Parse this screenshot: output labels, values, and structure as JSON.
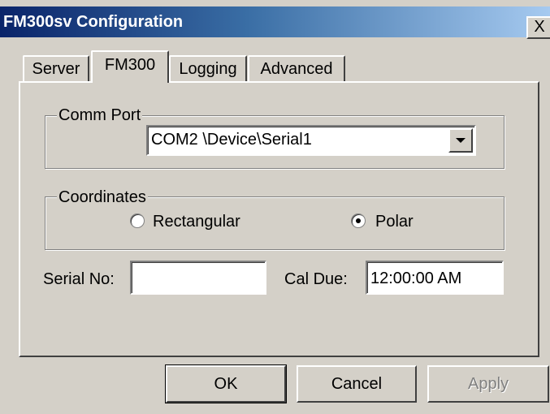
{
  "window": {
    "title": "FM300sv Configuration",
    "close_glyph": "X"
  },
  "tabs": [
    {
      "label": "Server",
      "active": false
    },
    {
      "label": "FM300",
      "active": true
    },
    {
      "label": "Logging",
      "active": false
    },
    {
      "label": "Advanced",
      "active": false
    }
  ],
  "comm_port": {
    "group_label": "Comm Port",
    "selected": "COM2 \\Device\\Serial1"
  },
  "coordinates": {
    "group_label": "Coordinates",
    "options": [
      {
        "label": "Rectangular",
        "selected": false
      },
      {
        "label": "Polar",
        "selected": true
      }
    ]
  },
  "serial": {
    "label": "Serial No:",
    "value": ""
  },
  "cal_due": {
    "label": "Cal Due:",
    "value": "12:00:00 AM"
  },
  "buttons": {
    "ok": "OK",
    "cancel": "Cancel",
    "apply": "Apply"
  },
  "colors": {
    "face": "#d4d0c8",
    "title_start": "#0a246a",
    "title_end": "#a6caf0"
  }
}
